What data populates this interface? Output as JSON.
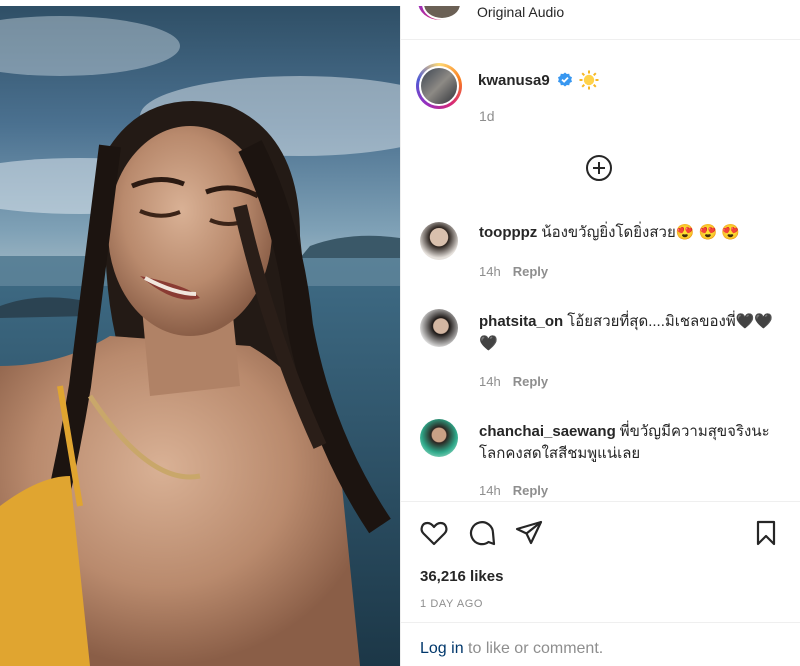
{
  "audio": {
    "label": "Original Audio"
  },
  "post": {
    "username": "kwanusa9",
    "time": "1d",
    "likes": "36,216 likes",
    "posted": "1 DAY AGO"
  },
  "comments": [
    {
      "username": "toopppz",
      "text": "น้องขวัญยิ่งโดยิ่งสวย😍 😍 😍",
      "time": "14h",
      "reply": "Reply"
    },
    {
      "username": "phatsita_on",
      "text": "โอ้ยสวยที่สุด....มิเชลของพี่🖤🖤🖤",
      "time": "14h",
      "reply": "Reply"
    },
    {
      "username": "chanchai_saewang",
      "text": "พี่ขวัญมีความสุขจริงนะ โลกคงสดใสสีชมพูแน่เลย",
      "time": "14h",
      "reply": "Reply"
    }
  ],
  "footer": {
    "login_link": "Log in",
    "login_rest": "to like or comment."
  },
  "colors": {
    "verified": "#3897f0",
    "link": "#00376b",
    "muted": "#8e8e8e"
  }
}
